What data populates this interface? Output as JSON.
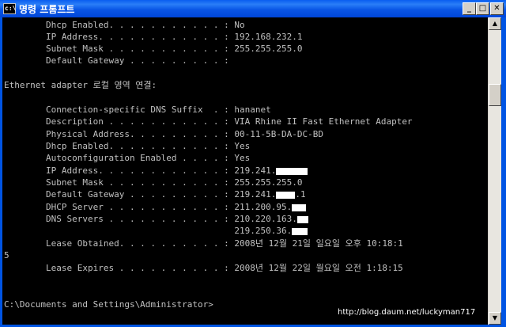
{
  "window": {
    "title": "명령 프롬프트",
    "icon_text": "c:\\",
    "controls": {
      "minimize": "_",
      "maximize": "□",
      "close": "✕"
    }
  },
  "console": {
    "lines": [
      "        Dhcp Enabled. . . . . . . . . . . : No",
      "        IP Address. . . . . . . . . . . . : 192.168.232.1",
      "        Subnet Mask . . . . . . . . . . . : 255.255.255.0",
      "        Default Gateway . . . . . . . . . :",
      "",
      "Ethernet adapter 로컬 영역 연결:",
      "",
      "        Connection-specific DNS Suffix  . : hananet",
      "        Description . . . . . . . . . . . : VIA Rhine II Fast Ethernet Adapter",
      "        Physical Address. . . . . . . . . : 00-11-5B-DA-DC-BD",
      "        Dhcp Enabled. . . . . . . . . . . : Yes",
      "        Autoconfiguration Enabled . . . . : Yes",
      "        IP Address. . . . . . . . . . . . : 219.241.",
      "        Subnet Mask . . . . . . . . . . . : 255.255.255.0",
      "        Default Gateway . . . . . . . . . : 219.241.",
      "        DHCP Server . . . . . . . . . . . : 211.200.95.",
      "        DNS Servers . . . . . . . . . . . : 210.220.163.",
      "                                            219.250.36.",
      "        Lease Obtained. . . . . . . . . . : 2008년 12월 21일 일요일 오후 10:18:1",
      "5",
      "        Lease Expires . . . . . . . . . . : 2008년 12월 22일 월요일 오전 1:18:15",
      "",
      "",
      "C:\\Documents and Settings\\Administrator>"
    ],
    "gateway_suffix": ".1"
  },
  "watermark": "http://blog.daum.net/luckyman717"
}
